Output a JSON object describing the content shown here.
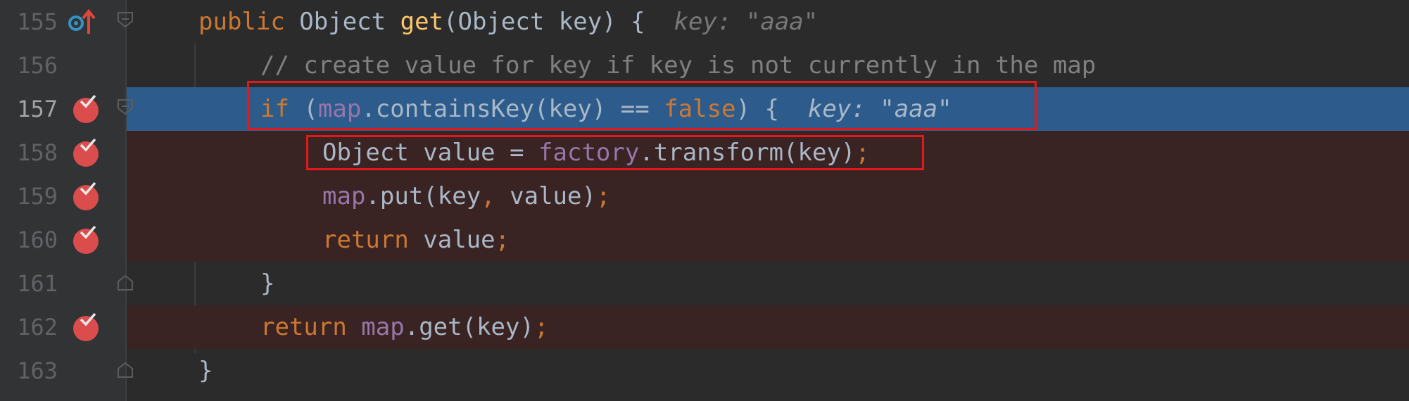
{
  "lines": [
    {
      "num": "155",
      "tokens": [
        "public ",
        "Object ",
        "get",
        "(Object key) {",
        "  key: \"aaa\""
      ]
    },
    {
      "num": "156",
      "tokens": [
        "// create value for key if key is not currently in the map"
      ]
    },
    {
      "num": "157",
      "tokens": [
        "if ",
        "(",
        "map",
        ".containsKey(key) == ",
        "false",
        ") {",
        "  key: \"aaa\""
      ]
    },
    {
      "num": "158",
      "tokens": [
        "Object value = ",
        "factory",
        ".transform(key)",
        ";"
      ]
    },
    {
      "num": "159",
      "tokens": [
        "map",
        ".put(key",
        ", ",
        "value)",
        ";"
      ]
    },
    {
      "num": "160",
      "tokens": [
        "return ",
        "value",
        ";"
      ]
    },
    {
      "num": "161",
      "tokens": [
        "}"
      ]
    },
    {
      "num": "162",
      "tokens": [
        "return ",
        "map",
        ".get(key)",
        ";"
      ]
    },
    {
      "num": "163",
      "tokens": [
        "}"
      ]
    }
  ],
  "colors": {
    "background": "#2b2b2b",
    "breakpoint_line": "#3a2323",
    "execution_line": "#2d5c8c",
    "breakpoint": "#db4d4d",
    "highlight_box": "#e0191c"
  },
  "icons": {
    "line155": "implements-method-icon",
    "breakpoints": [
      "157",
      "158",
      "159",
      "160",
      "162"
    ]
  }
}
